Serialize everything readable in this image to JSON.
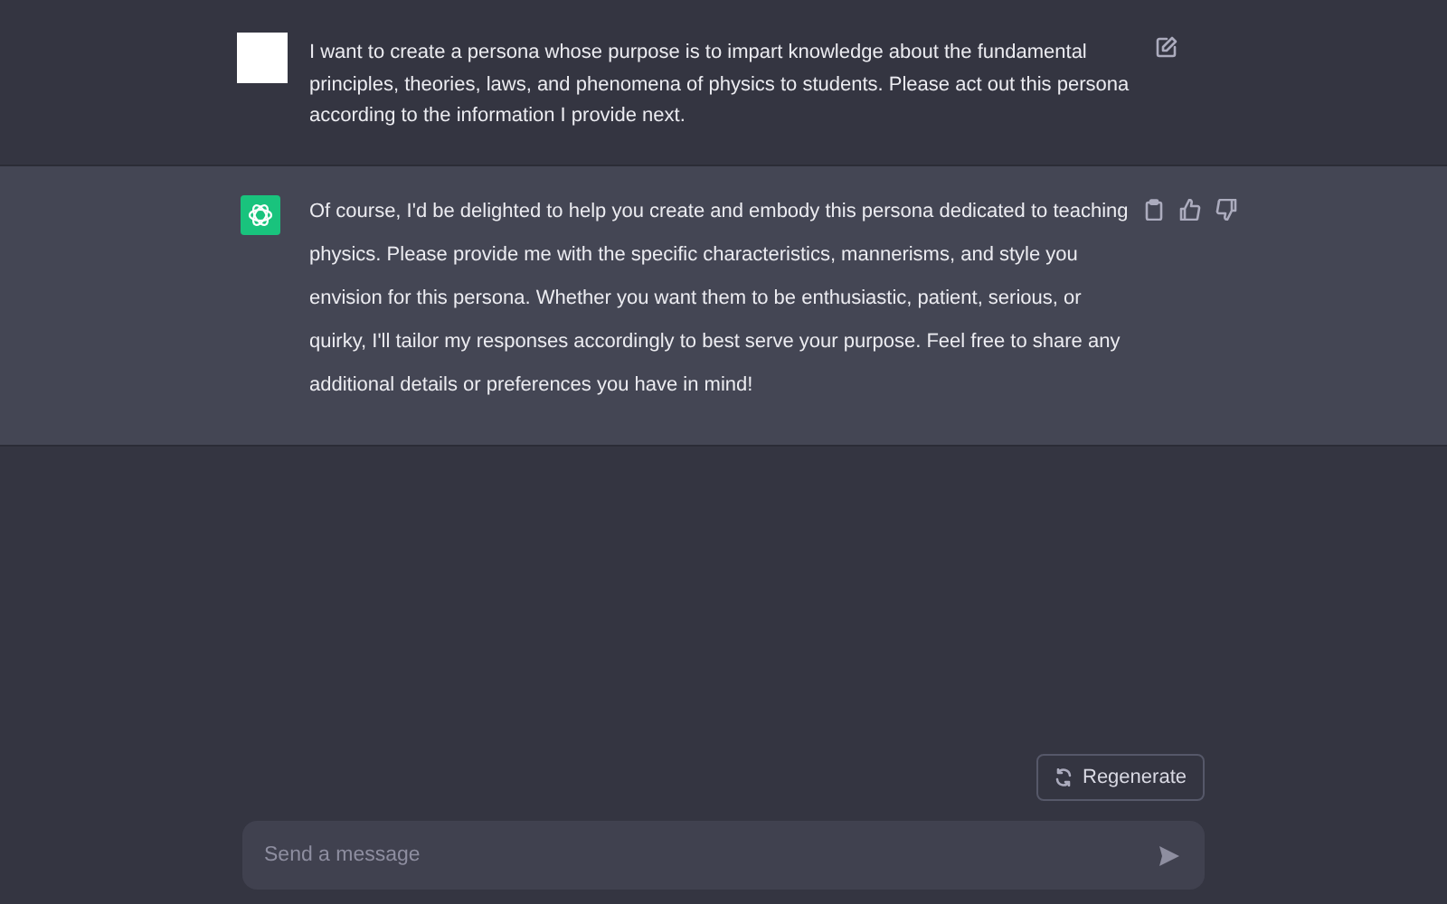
{
  "messages": [
    {
      "kind": "user",
      "text": "I want to create a persona whose purpose is to impart knowledge about the fundamental principles, theories, laws, and phenomena of physics to students. Please act out this persona according to the information I provide next."
    },
    {
      "kind": "assistant",
      "text": "Of course, I'd be delighted to help you create and embody this persona dedicated to teaching physics. Please provide me with the specific characteristics, mannerisms, and style you envision for this persona. Whether you want them to be enthusiastic, patient, serious, or quirky, I'll tailor my responses accordingly to best serve your purpose. Feel free to share any additional details or preferences you have in mind!"
    }
  ],
  "regenerate": {
    "label": "Regenerate"
  },
  "composer": {
    "placeholder": "Send a message"
  }
}
